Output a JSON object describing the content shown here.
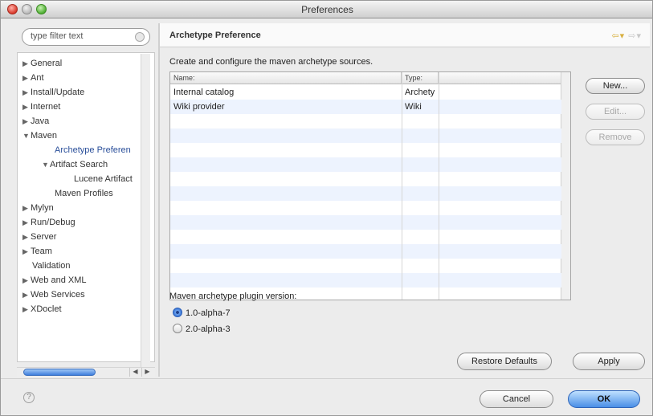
{
  "window": {
    "title": "Preferences"
  },
  "sidebar": {
    "filter_placeholder": "type filter text",
    "items": [
      {
        "label": "General",
        "arrow": "▶"
      },
      {
        "label": "Ant",
        "arrow": "▶"
      },
      {
        "label": "Install/Update",
        "arrow": "▶"
      },
      {
        "label": "Internet",
        "arrow": "▶"
      },
      {
        "label": "Java",
        "arrow": "▶"
      },
      {
        "label": "Maven",
        "arrow": "▼"
      },
      {
        "label": "Archetype Preferen",
        "arrow": ""
      },
      {
        "label": "Artifact Search",
        "arrow": "▼"
      },
      {
        "label": "Lucene Artifact",
        "arrow": ""
      },
      {
        "label": "Maven Profiles",
        "arrow": ""
      },
      {
        "label": "Mylyn",
        "arrow": "▶"
      },
      {
        "label": "Run/Debug",
        "arrow": "▶"
      },
      {
        "label": "Server",
        "arrow": "▶"
      },
      {
        "label": "Team",
        "arrow": "▶"
      },
      {
        "label": "Validation",
        "arrow": ""
      },
      {
        "label": "Web and XML",
        "arrow": "▶"
      },
      {
        "label": "Web Services",
        "arrow": "▶"
      },
      {
        "label": "XDoclet",
        "arrow": "▶"
      }
    ]
  },
  "page": {
    "title": "Archetype Preference",
    "description": "Create and configure the maven archetype sources.",
    "table": {
      "columns": [
        "Name:",
        "Type:"
      ],
      "rows": [
        {
          "name": "Internal catalog",
          "type": "Archety"
        },
        {
          "name": "Wiki provider",
          "type": "Wiki"
        }
      ]
    },
    "buttons": {
      "new": "New...",
      "edit": "Edit...",
      "remove": "Remove"
    },
    "version_label": "Maven archetype plugin version:",
    "versions": [
      {
        "label": "1.0-alpha-7",
        "checked": true
      },
      {
        "label": "2.0-alpha-3",
        "checked": false
      }
    ],
    "restore_defaults": "Restore Defaults",
    "apply": "Apply"
  },
  "footer": {
    "help": "?",
    "cancel": "Cancel",
    "ok": "OK"
  },
  "colors": {
    "selection": "#2a4f9a",
    "row_alt": "#edf3fe",
    "ok_button": "#4a8fe6"
  }
}
